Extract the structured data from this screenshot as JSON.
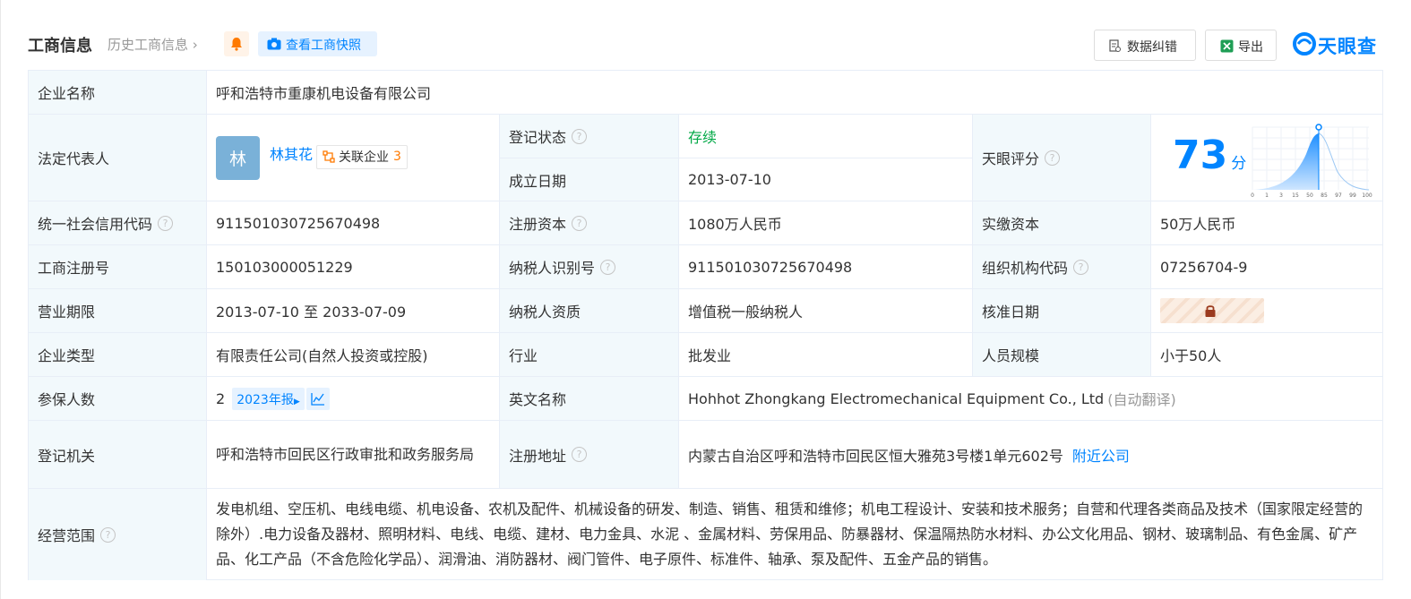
{
  "header": {
    "title": "工商信息",
    "history_link": "历史工商信息",
    "snapshot_button": "查看工商快照",
    "fix_button": "数据纠错",
    "export_button": "导出",
    "logo_text": "天眼查"
  },
  "labels": {
    "company_name": "企业名称",
    "legal_rep": "法定代表人",
    "reg_status": "登记状态",
    "found_date": "成立日期",
    "tianyan_score": "天眼评分",
    "credit_code": "统一社会信用代码",
    "reg_capital": "注册资本",
    "paid_capital": "实缴资本",
    "biz_reg_no": "工商注册号",
    "taxpayer_id": "纳税人识别号",
    "org_code": "组织机构代码",
    "biz_term": "营业期限",
    "taxpayer_qual": "纳税人资质",
    "approval_date": "核准日期",
    "company_type": "企业类型",
    "industry": "行业",
    "staff_size": "人员规模",
    "insured": "参保人数",
    "english_name": "英文名称",
    "reg_authority": "登记机关",
    "reg_address": "注册地址",
    "biz_scope": "经营范围"
  },
  "values": {
    "company_name": "呼和浩特市重康机电设备有限公司",
    "legal_rep_avatar": "林",
    "legal_rep_name": "林其花",
    "related_label": "关联企业",
    "related_count": "3",
    "reg_status": "存续",
    "found_date": "2013-07-10",
    "score_value": "73",
    "score_unit": "分",
    "score_axis": [
      "0",
      "1",
      "3",
      "15",
      "50",
      "85",
      "97",
      "99",
      "100"
    ],
    "credit_code": "911501030725670498",
    "reg_capital": "1080万人民币",
    "paid_capital": "50万人民币",
    "biz_reg_no": "150103000051229",
    "taxpayer_id": "911501030725670498",
    "org_code": "07256704-9",
    "biz_term": "2013-07-10 至 2033-07-09",
    "taxpayer_qual": "增值税一般纳税人",
    "company_type": "有限责任公司(自然人投资或控股)",
    "industry": "批发业",
    "staff_size": "小于50人",
    "insured_count": "2",
    "insured_report": "2023年报",
    "english_name": "Hohhot Zhongkang Electromechanical Equipment Co., Ltd",
    "english_note": "(自动翻译)",
    "reg_authority": "呼和浩特市回民区行政审批和政务服务局",
    "reg_address": "内蒙古自治区呼和浩特市回民区恒大雅苑3号楼1单元602号",
    "nearby": "附近公司",
    "biz_scope": "发电机组、空压机、电线电缆、机电设备、农机及配件、机械设备的研发、制造、销售、租赁和维修；机电工程设计、安装和技术服务；自营和代理各类商品及技术（国家限定经营的除外）.电力设备及器材、照明材料、电线、电缆、建材、电力金具、水泥 、金属材料、劳保用品、防暴器材、保温隔热防水材料、办公文化用品、钢材、玻璃制品、有色金属、矿产品、化工产品（不含危险化学品）、润滑油、消防器材、阀门管件、电子原件、标准件、轴承、泵及配件、五金产品的销售。"
  },
  "colors": {
    "accent": "#0084ff",
    "status_green": "#00a846",
    "label_bg": "#f2f9fc",
    "orange": "#ff7a00"
  },
  "icons": [
    "bell-icon",
    "camera-icon",
    "edit-doc-icon",
    "excel-icon",
    "logo-mark-icon",
    "question-icon",
    "relation-icon",
    "lock-icon",
    "trend-chart-icon",
    "chevron-right-icon"
  ]
}
